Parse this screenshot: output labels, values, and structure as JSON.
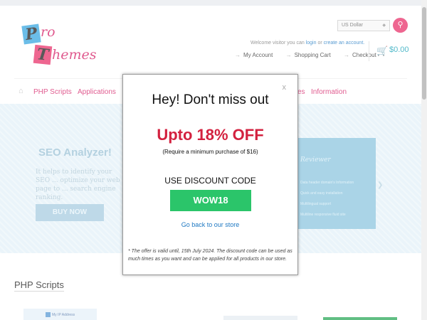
{
  "header": {
    "logo_letters": [
      "P",
      "T"
    ],
    "logo_words": [
      "ro",
      "hemes"
    ],
    "currency": "US Dollar",
    "welcome": {
      "prefix": "Welcome visitor you can",
      "login": "login",
      "or": "or",
      "create": "create an account."
    },
    "account_links": [
      "My Account",
      "Shopping Cart",
      "Checkout"
    ],
    "cart_total": "$0.00"
  },
  "nav": {
    "items": [
      "PHP Scripts",
      "Applications",
      "es",
      "Information"
    ]
  },
  "banner": {
    "title": "SEO Analyzer!",
    "text": "It helps to identify your SEO ... optimize your web page to ... search engine ranking.",
    "buy_button": "BUY NOW",
    "panel_title": "Reviewer",
    "panel_lines": [
      "Data header domain's Information",
      "Quick and easy installation",
      "Multilingual support",
      "Multiline responsive fluid site"
    ]
  },
  "section": {
    "title": "PHP Scripts",
    "thumb_label": "My IP Address"
  },
  "modal": {
    "close": "x",
    "heading": "Hey! Don't miss out",
    "offer": "Upto 18% OFF",
    "requirement": "(Require a minimum purchase of $16)",
    "use_code": "USE DISCOUNT CODE",
    "code": "WOW18",
    "back_link": "Go back to our store",
    "fine_print": "* The offer is valid until, 15th July 2024. The discount code can be used as much times as you want and can be applied for all products in our store."
  },
  "colors": {
    "brand_pink": "#d6246a",
    "offer_red": "#d3213f",
    "code_green": "#2bc56a",
    "link_blue": "#1e78c2"
  }
}
